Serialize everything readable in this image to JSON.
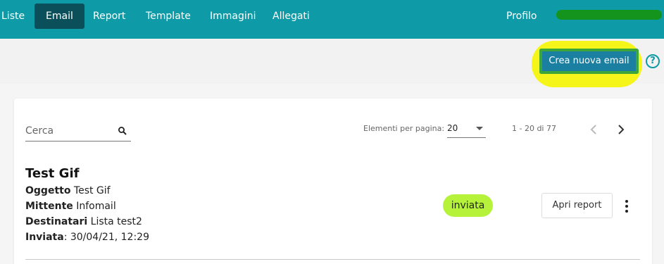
{
  "nav": {
    "items": [
      {
        "label": "Liste"
      },
      {
        "label": "Email",
        "active": true
      },
      {
        "label": "Report"
      },
      {
        "label": "Template"
      },
      {
        "label": "Immagini"
      },
      {
        "label": "Allegati"
      }
    ],
    "profile_label": "Profilo",
    "background": "#0e9aa7"
  },
  "actions": {
    "create_label": "Crea nuova email",
    "help_symbol": "?"
  },
  "list": {
    "search_placeholder": "Cerca",
    "per_page_label": "Elementi per pagina:",
    "per_page_value": "20",
    "range": "1 - 20 di 77"
  },
  "emails": [
    {
      "title": "Test Gif",
      "subject_label": "Oggetto",
      "subject": "Test Gif",
      "sender_label": "Mittente",
      "sender": "Infomail",
      "recipients_label": "Destinatari",
      "recipients": "Lista test2",
      "sent_label": "Inviata",
      "sent": "30/04/21, 12:29",
      "status": "inviata",
      "status_color": "#b7f23a",
      "report_label": "Apri report"
    }
  ]
}
